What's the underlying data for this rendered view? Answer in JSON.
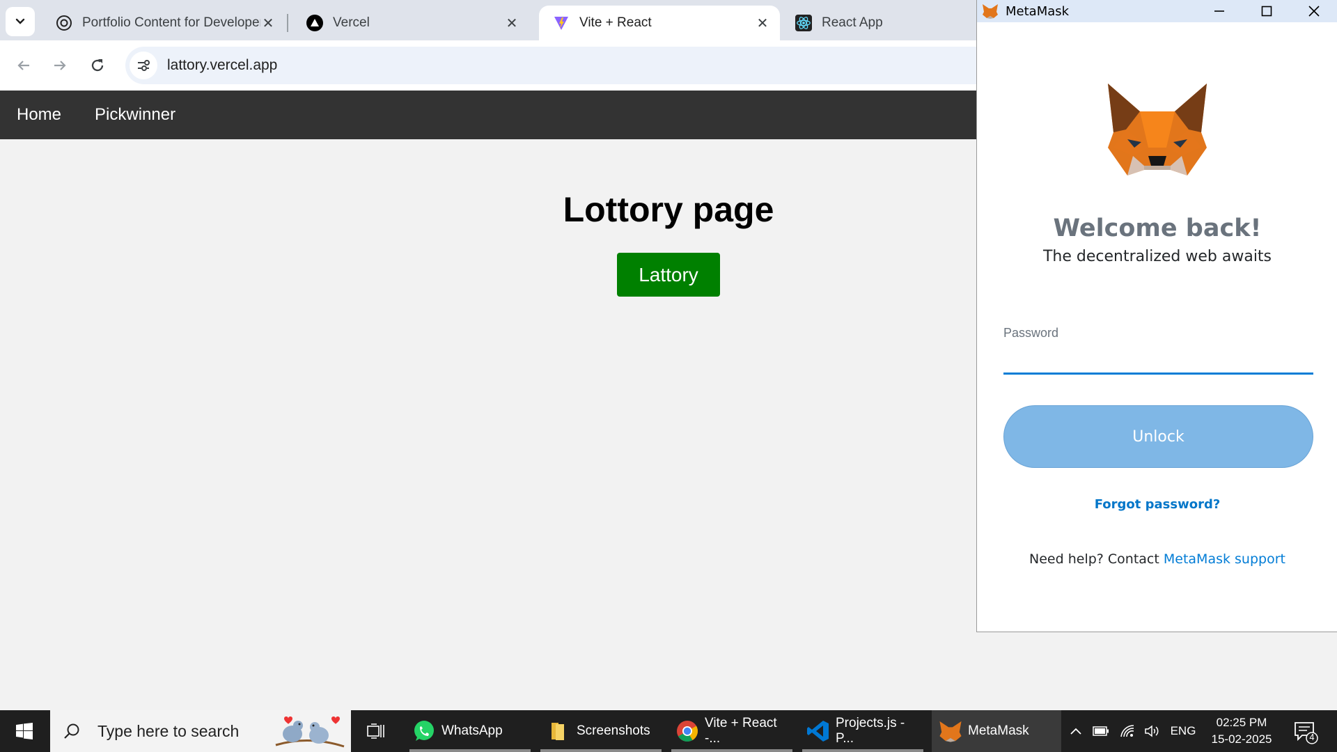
{
  "browser": {
    "tabs": [
      {
        "title": "Portfolio Content for Developer",
        "icon": "openai-icon"
      },
      {
        "title": "Vercel",
        "icon": "vercel-icon"
      },
      {
        "title": "Vite + React",
        "icon": "vite-icon",
        "active": true
      },
      {
        "title": "React App",
        "icon": "react-icon"
      }
    ],
    "url": "lattory.vercel.app"
  },
  "page": {
    "nav": [
      "Home",
      "Pickwinner"
    ],
    "heading": "Lottory page",
    "button": "Lattory",
    "colors": {
      "nav_bg": "#333333",
      "button_bg": "#008000",
      "page_bg": "#f2f2f2"
    }
  },
  "metamask": {
    "window_title": "MetaMask",
    "welcome": "Welcome back!",
    "tagline": "The decentralized web awaits",
    "password_label": "Password",
    "password_value": "",
    "unlock": "Unlock",
    "forgot": "Forgot password?",
    "help_prefix": "Need help? Contact ",
    "help_link": "MetaMask support",
    "colors": {
      "unlock_bg": "#7fb7e6",
      "link": "#037dd6"
    }
  },
  "taskbar": {
    "search_placeholder": "Type here to search",
    "apps": [
      {
        "label": "WhatsApp",
        "icon": "whatsapp-icon"
      },
      {
        "label": "Screenshots",
        "icon": "folder-icon"
      },
      {
        "label": "Vite + React -...",
        "icon": "chrome-icon"
      },
      {
        "label": "Projects.js - P...",
        "icon": "vscode-icon"
      },
      {
        "label": "MetaMask",
        "icon": "metamask-icon",
        "active": true
      }
    ],
    "language": "ENG",
    "time": "02:25 PM",
    "date": "15-02-2025",
    "notifications": "4"
  }
}
